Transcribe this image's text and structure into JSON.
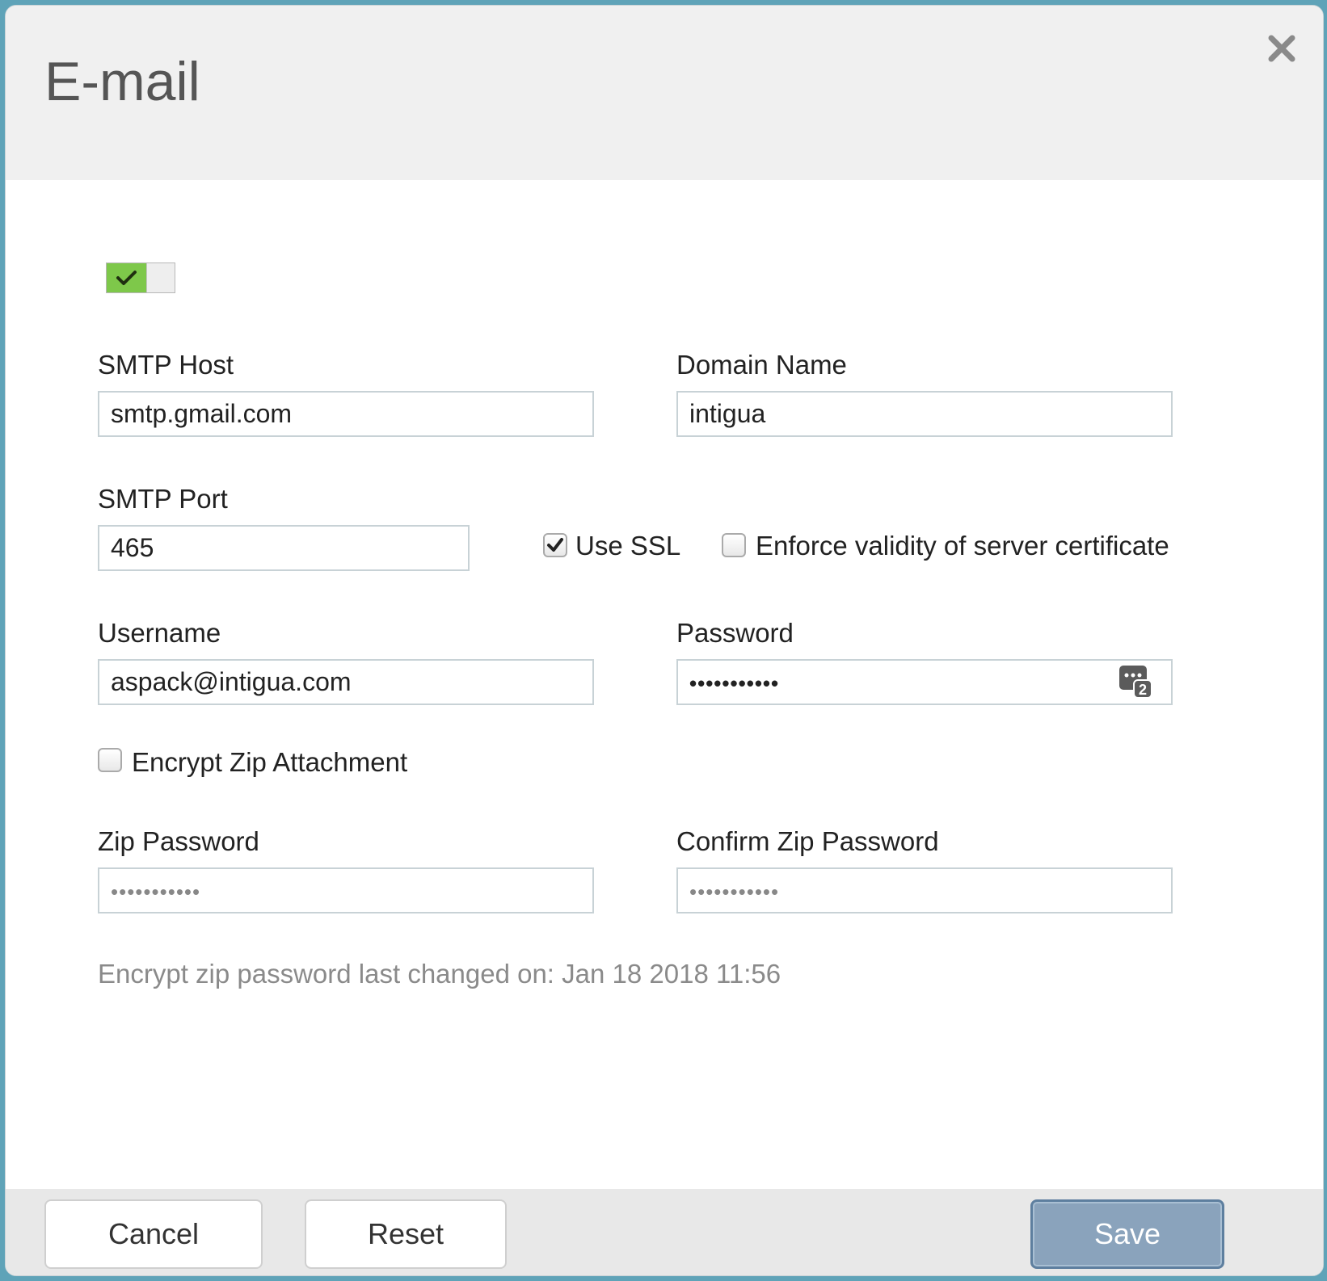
{
  "dialog": {
    "title": "E-mail",
    "close_icon": "close-icon"
  },
  "toggle": {
    "enabled": true,
    "icon": "checkmark-icon",
    "accent": "#7ec84a"
  },
  "form": {
    "smtp_host": {
      "label": "SMTP Host",
      "value": "smtp.gmail.com"
    },
    "domain_name": {
      "label": "Domain Name",
      "value": "intigua"
    },
    "smtp_port": {
      "label": "SMTP Port",
      "value": "465"
    },
    "use_ssl": {
      "label": "Use SSL",
      "checked": true
    },
    "enforce_cert": {
      "label": "Enforce validity of server certificate",
      "checked": false
    },
    "username": {
      "label": "Username",
      "value": "aspack@intigua.com"
    },
    "password": {
      "label": "Password",
      "value": "•••••••••••",
      "icon": "password-generator-icon"
    },
    "encrypt_zip": {
      "label": "Encrypt Zip Attachment",
      "checked": false
    },
    "zip_password": {
      "label": "Zip Password",
      "value": "•••••••••••"
    },
    "confirm_zip_password": {
      "label": "Confirm Zip Password",
      "value": "•••••••••••"
    },
    "last_changed": "Encrypt zip password last changed on: Jan 18 2018 11:56"
  },
  "footer": {
    "cancel_label": "Cancel",
    "reset_label": "Reset",
    "save_label": "Save"
  }
}
